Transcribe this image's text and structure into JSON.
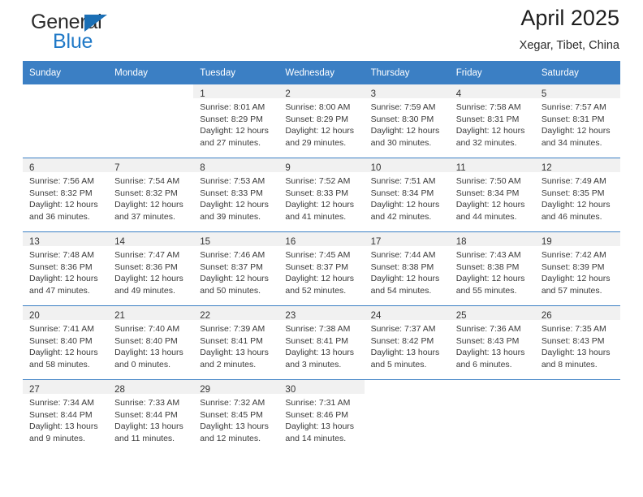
{
  "brand": {
    "line1": "General",
    "line2": "Blue",
    "triangle_icon": "brand-triangle-icon",
    "colors": {
      "blue": "#2079c7",
      "dark": "#2b2b2b",
      "triangle": "#1b6fb5"
    }
  },
  "header": {
    "title": "April 2025",
    "subtitle": "Xegar, Tibet, China"
  },
  "calendar": {
    "header_color": "#3b7fc4",
    "weekday_headers": [
      "Sunday",
      "Monday",
      "Tuesday",
      "Wednesday",
      "Thursday",
      "Friday",
      "Saturday"
    ],
    "weeks": [
      [
        {
          "day": "",
          "lines": []
        },
        {
          "day": "",
          "lines": []
        },
        {
          "day": "1",
          "lines": [
            "Sunrise: 8:01 AM",
            "Sunset: 8:29 PM",
            "Daylight: 12 hours",
            "and 27 minutes."
          ]
        },
        {
          "day": "2",
          "lines": [
            "Sunrise: 8:00 AM",
            "Sunset: 8:29 PM",
            "Daylight: 12 hours",
            "and 29 minutes."
          ]
        },
        {
          "day": "3",
          "lines": [
            "Sunrise: 7:59 AM",
            "Sunset: 8:30 PM",
            "Daylight: 12 hours",
            "and 30 minutes."
          ]
        },
        {
          "day": "4",
          "lines": [
            "Sunrise: 7:58 AM",
            "Sunset: 8:31 PM",
            "Daylight: 12 hours",
            "and 32 minutes."
          ]
        },
        {
          "day": "5",
          "lines": [
            "Sunrise: 7:57 AM",
            "Sunset: 8:31 PM",
            "Daylight: 12 hours",
            "and 34 minutes."
          ]
        }
      ],
      [
        {
          "day": "6",
          "lines": [
            "Sunrise: 7:56 AM",
            "Sunset: 8:32 PM",
            "Daylight: 12 hours",
            "and 36 minutes."
          ]
        },
        {
          "day": "7",
          "lines": [
            "Sunrise: 7:54 AM",
            "Sunset: 8:32 PM",
            "Daylight: 12 hours",
            "and 37 minutes."
          ]
        },
        {
          "day": "8",
          "lines": [
            "Sunrise: 7:53 AM",
            "Sunset: 8:33 PM",
            "Daylight: 12 hours",
            "and 39 minutes."
          ]
        },
        {
          "day": "9",
          "lines": [
            "Sunrise: 7:52 AM",
            "Sunset: 8:33 PM",
            "Daylight: 12 hours",
            "and 41 minutes."
          ]
        },
        {
          "day": "10",
          "lines": [
            "Sunrise: 7:51 AM",
            "Sunset: 8:34 PM",
            "Daylight: 12 hours",
            "and 42 minutes."
          ]
        },
        {
          "day": "11",
          "lines": [
            "Sunrise: 7:50 AM",
            "Sunset: 8:34 PM",
            "Daylight: 12 hours",
            "and 44 minutes."
          ]
        },
        {
          "day": "12",
          "lines": [
            "Sunrise: 7:49 AM",
            "Sunset: 8:35 PM",
            "Daylight: 12 hours",
            "and 46 minutes."
          ]
        }
      ],
      [
        {
          "day": "13",
          "lines": [
            "Sunrise: 7:48 AM",
            "Sunset: 8:36 PM",
            "Daylight: 12 hours",
            "and 47 minutes."
          ]
        },
        {
          "day": "14",
          "lines": [
            "Sunrise: 7:47 AM",
            "Sunset: 8:36 PM",
            "Daylight: 12 hours",
            "and 49 minutes."
          ]
        },
        {
          "day": "15",
          "lines": [
            "Sunrise: 7:46 AM",
            "Sunset: 8:37 PM",
            "Daylight: 12 hours",
            "and 50 minutes."
          ]
        },
        {
          "day": "16",
          "lines": [
            "Sunrise: 7:45 AM",
            "Sunset: 8:37 PM",
            "Daylight: 12 hours",
            "and 52 minutes."
          ]
        },
        {
          "day": "17",
          "lines": [
            "Sunrise: 7:44 AM",
            "Sunset: 8:38 PM",
            "Daylight: 12 hours",
            "and 54 minutes."
          ]
        },
        {
          "day": "18",
          "lines": [
            "Sunrise: 7:43 AM",
            "Sunset: 8:38 PM",
            "Daylight: 12 hours",
            "and 55 minutes."
          ]
        },
        {
          "day": "19",
          "lines": [
            "Sunrise: 7:42 AM",
            "Sunset: 8:39 PM",
            "Daylight: 12 hours",
            "and 57 minutes."
          ]
        }
      ],
      [
        {
          "day": "20",
          "lines": [
            "Sunrise: 7:41 AM",
            "Sunset: 8:40 PM",
            "Daylight: 12 hours",
            "and 58 minutes."
          ]
        },
        {
          "day": "21",
          "lines": [
            "Sunrise: 7:40 AM",
            "Sunset: 8:40 PM",
            "Daylight: 13 hours",
            "and 0 minutes."
          ]
        },
        {
          "day": "22",
          "lines": [
            "Sunrise: 7:39 AM",
            "Sunset: 8:41 PM",
            "Daylight: 13 hours",
            "and 2 minutes."
          ]
        },
        {
          "day": "23",
          "lines": [
            "Sunrise: 7:38 AM",
            "Sunset: 8:41 PM",
            "Daylight: 13 hours",
            "and 3 minutes."
          ]
        },
        {
          "day": "24",
          "lines": [
            "Sunrise: 7:37 AM",
            "Sunset: 8:42 PM",
            "Daylight: 13 hours",
            "and 5 minutes."
          ]
        },
        {
          "day": "25",
          "lines": [
            "Sunrise: 7:36 AM",
            "Sunset: 8:43 PM",
            "Daylight: 13 hours",
            "and 6 minutes."
          ]
        },
        {
          "day": "26",
          "lines": [
            "Sunrise: 7:35 AM",
            "Sunset: 8:43 PM",
            "Daylight: 13 hours",
            "and 8 minutes."
          ]
        }
      ],
      [
        {
          "day": "27",
          "lines": [
            "Sunrise: 7:34 AM",
            "Sunset: 8:44 PM",
            "Daylight: 13 hours",
            "and 9 minutes."
          ]
        },
        {
          "day": "28",
          "lines": [
            "Sunrise: 7:33 AM",
            "Sunset: 8:44 PM",
            "Daylight: 13 hours",
            "and 11 minutes."
          ]
        },
        {
          "day": "29",
          "lines": [
            "Sunrise: 7:32 AM",
            "Sunset: 8:45 PM",
            "Daylight: 13 hours",
            "and 12 minutes."
          ]
        },
        {
          "day": "30",
          "lines": [
            "Sunrise: 7:31 AM",
            "Sunset: 8:46 PM",
            "Daylight: 13 hours",
            "and 14 minutes."
          ]
        },
        {
          "day": "",
          "lines": []
        },
        {
          "day": "",
          "lines": []
        },
        {
          "day": "",
          "lines": []
        }
      ]
    ]
  }
}
